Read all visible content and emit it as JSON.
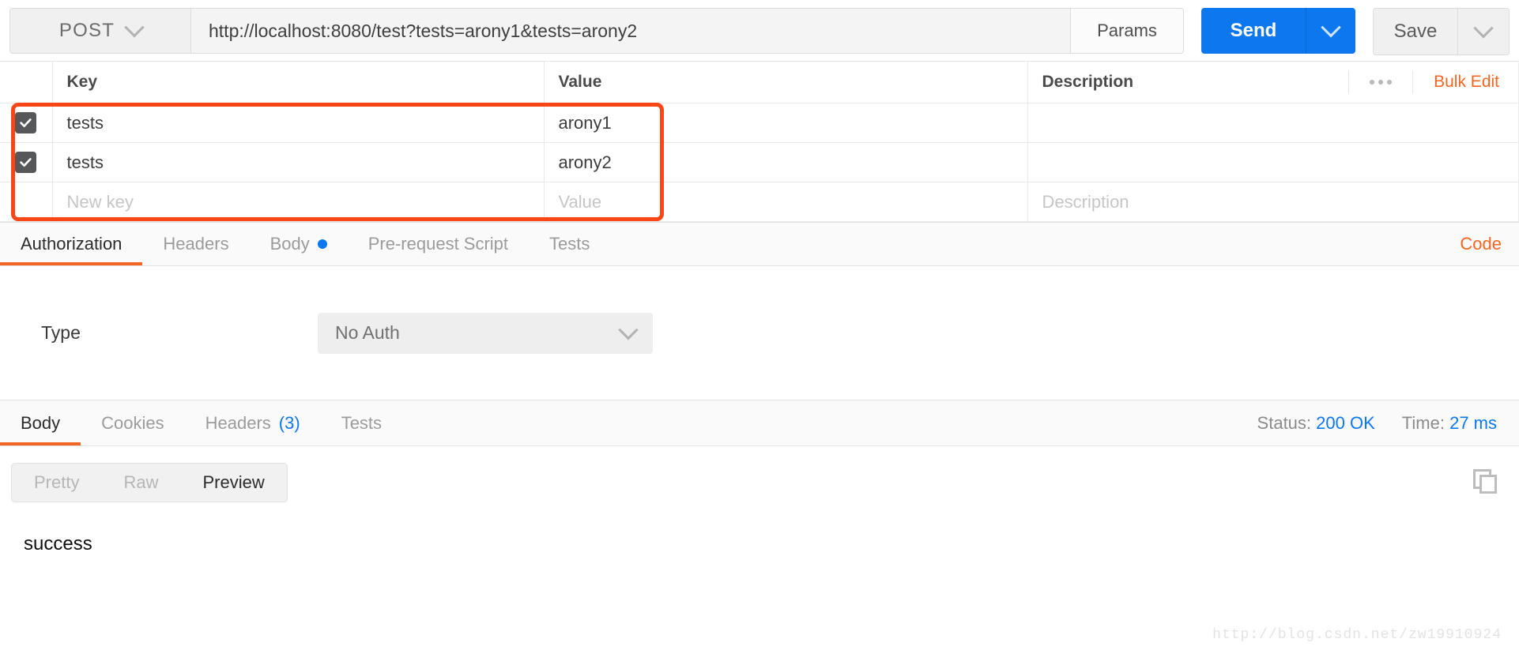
{
  "request_bar": {
    "method": "POST",
    "url": "http://localhost:8080/test?tests=arony1&tests=arony2",
    "params_button": "Params",
    "send_button": "Send",
    "save_button": "Save"
  },
  "params_table": {
    "columns": [
      "Key",
      "Value",
      "Description"
    ],
    "options_icon": "ellipsis-icon",
    "bulk_edit": "Bulk Edit",
    "rows": [
      {
        "checked": true,
        "key": "tests",
        "value": "arony1",
        "description": ""
      },
      {
        "checked": true,
        "key": "tests",
        "value": "arony2",
        "description": ""
      }
    ],
    "new_row": {
      "key_placeholder": "New key",
      "value_placeholder": "Value",
      "description_placeholder": "Description"
    },
    "highlight_color": "#fa4616"
  },
  "request_tabs": {
    "items": [
      {
        "label": "Authorization",
        "active": true,
        "dot": false
      },
      {
        "label": "Headers",
        "active": false,
        "dot": false
      },
      {
        "label": "Body",
        "active": false,
        "dot": true
      },
      {
        "label": "Pre-request Script",
        "active": false,
        "dot": false
      },
      {
        "label": "Tests",
        "active": false,
        "dot": false
      }
    ],
    "code_link": "Code",
    "accent_color": "#f26522"
  },
  "auth_panel": {
    "type_label": "Type",
    "type_value": "No Auth",
    "chevron_icon": "chevron-down-icon"
  },
  "response": {
    "tabs": [
      {
        "label": "Body",
        "count": "",
        "active": true
      },
      {
        "label": "Cookies",
        "count": "",
        "active": false
      },
      {
        "label": "Headers",
        "count": "(3)",
        "active": false
      },
      {
        "label": "Tests",
        "count": "",
        "active": false
      }
    ],
    "status_label": "Status:",
    "status_value": "200 OK",
    "time_label": "Time:",
    "time_value": "27 ms",
    "status_color": "#0c77ef",
    "format_modes": [
      {
        "label": "Pretty",
        "active": false
      },
      {
        "label": "Raw",
        "active": false
      },
      {
        "label": "Preview",
        "active": true
      }
    ],
    "copy_icon": "copy-icon",
    "body_text": "success"
  },
  "watermark": "http://blog.csdn.net/zw19910924"
}
